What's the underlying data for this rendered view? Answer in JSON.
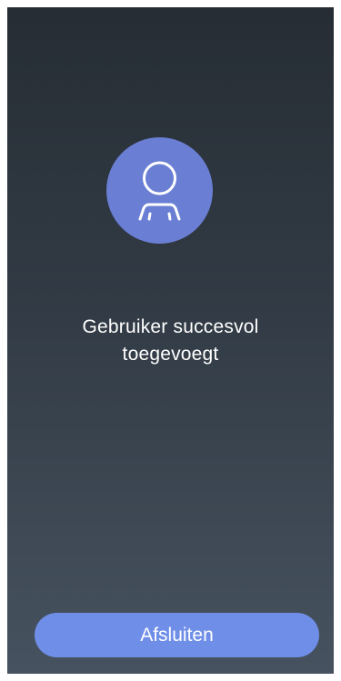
{
  "success": {
    "icon": "user-icon",
    "message_line1": "Gebruiker succesvol",
    "message_line2": "toegevoegt"
  },
  "actions": {
    "close_label": "Afsluiten"
  },
  "colors": {
    "accent_circle": "#6a7fd4",
    "button": "#6f8ee8",
    "background_top": "#262d34",
    "background_bottom": "#46525f"
  }
}
